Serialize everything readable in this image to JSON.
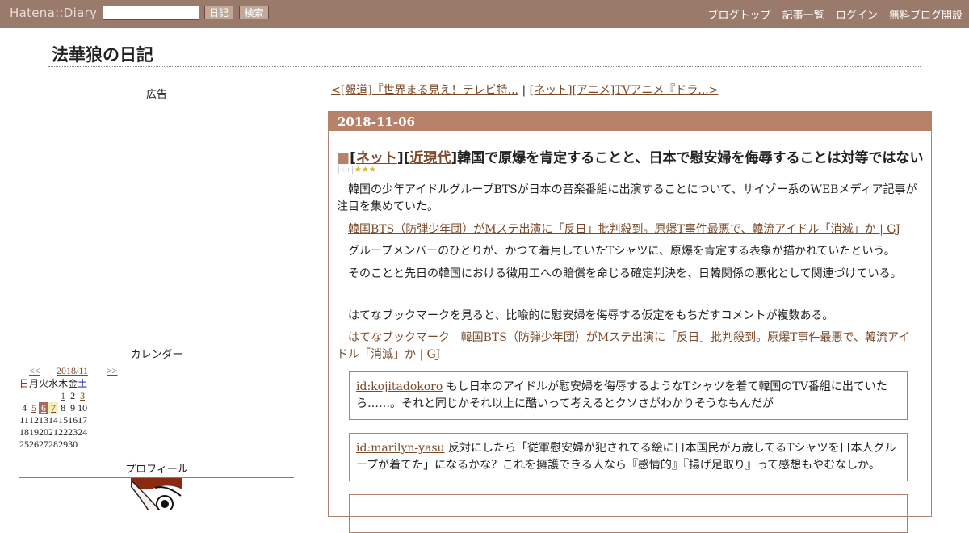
{
  "topbar": {
    "logo": "Hatena::Diary",
    "diary_button": "日記",
    "search_button": "検索",
    "nav": [
      "ブログトップ",
      "記事一覧",
      "ログイン",
      "無料ブログ開設"
    ]
  },
  "blog": {
    "title": "法華狼の日記"
  },
  "sidebar": {
    "ad_heading": "広告",
    "calendar_heading": "カレンダー",
    "profile_heading": "プロフィール",
    "calendar": {
      "prev": "<<",
      "month": "2018/11",
      "next": ">>",
      "weekdays": [
        "日",
        "月",
        "火",
        "水",
        "木",
        "金",
        "土"
      ],
      "weeks": [
        [
          "",
          "",
          "",
          "",
          "1",
          "2",
          "3"
        ],
        [
          "4",
          "5",
          "6",
          "7",
          "8",
          "9",
          "10"
        ],
        [
          "11",
          "12",
          "13",
          "14",
          "15",
          "16",
          "17"
        ],
        [
          "18",
          "19",
          "20",
          "21",
          "22",
          "23",
          "24"
        ],
        [
          "25",
          "26",
          "27",
          "28",
          "29",
          "30",
          ""
        ]
      ],
      "linked_days": [
        "1",
        "3",
        "5",
        "6",
        "7"
      ],
      "today": "6",
      "highlighted": "7"
    }
  },
  "pager": {
    "prev": "<[報道]『世界まる見え！テレビ特...",
    "separator": "|",
    "next": "[ネット][アニメ]TVアニメ『ドラ...>"
  },
  "entry": {
    "date": "2018-11-06",
    "title_prefix": "■",
    "cat1": "ネット",
    "cat2": "近現代",
    "title_text": "韓国で原爆を肯定することと、日本で慰安婦を侮辱することは対等ではない",
    "stars": "★★★",
    "p1": "韓国の少年アイドルグループBTSが日本の音楽番組に出演することについて、サイゾー系のWEBメディア記事が注目を集めていた。",
    "link1": "韓国BTS（防弾少年団）がMステ出演に「反日」批判殺到。原爆T事件最悪で、韓流アイドル「消滅」か | GJ",
    "p2": "グループメンバーのひとりが、かつて着用していたTシャツに、原爆を肯定する表象が描かれていたという。",
    "p3": "そのことと先日の韓国における徴用工への賠償を命じる確定判決を、日韓関係の悪化として関連づけている。",
    "p4": "はてなブックマークを見ると、比喩的に慰安婦を侮辱する仮定をもちだすコメントが複数ある。",
    "link2": "はてなブックマーク - 韓国BTS（防弾少年団）がMステ出演に「反日」批判殺到。原爆T事件最悪で、韓流アイドル「消滅」か | GJ",
    "comments": [
      {
        "user": "id:kojitadokoro",
        "text": "もし日本のアイドルが慰安婦を侮辱するようなTシャツを着て韓国のTV番組に出ていたら……。それと同じかそれ以上に酷いって考えるとクソさがわかりそうなもんだが"
      },
      {
        "user": "id:marilyn-yasu",
        "text": "反対にしたら「従軍慰安婦が犯されてる絵に日本国民が万歳してるTシャツを日本人グループが着てた」になるかな？これを擁護できる人なら『感情的』『揚げ足取り』って感想もやむなしか。"
      }
    ]
  }
}
